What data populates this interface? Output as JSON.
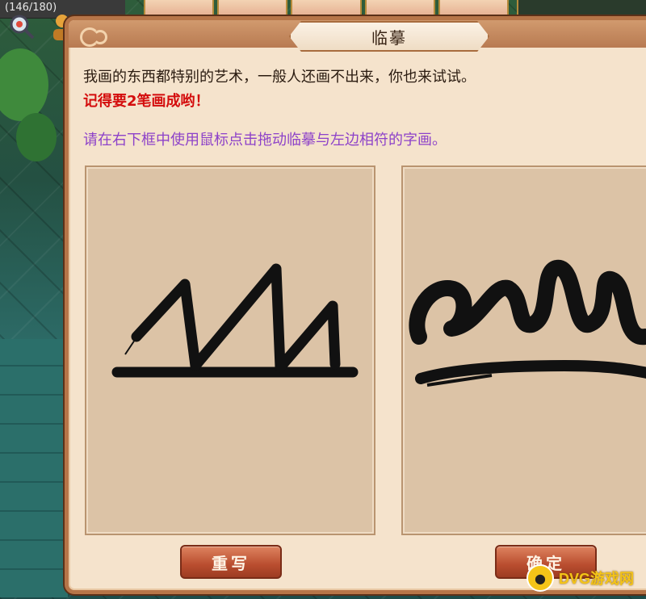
{
  "hud": {
    "hp_text": "(146/180)"
  },
  "dialog": {
    "title": "临摹",
    "line1": "我画的东西都特别的艺术，一般人还画不出来，你也来试试。",
    "line2": "记得要2笔画成哟！",
    "line3": "请在右下框中使用鼠标点击拖动临摹与左边相符的字画。"
  },
  "buttons": {
    "redraw": "重写",
    "confirm": "确定"
  },
  "watermark": {
    "text": "DVG游戏网"
  },
  "colors": {
    "instruction_text": "#2a1b10",
    "warning_text": "#d40d0d",
    "hint_text": "#8d42c9",
    "panel_bg": "#dcc3a6",
    "dialog_border": "#b67548"
  }
}
